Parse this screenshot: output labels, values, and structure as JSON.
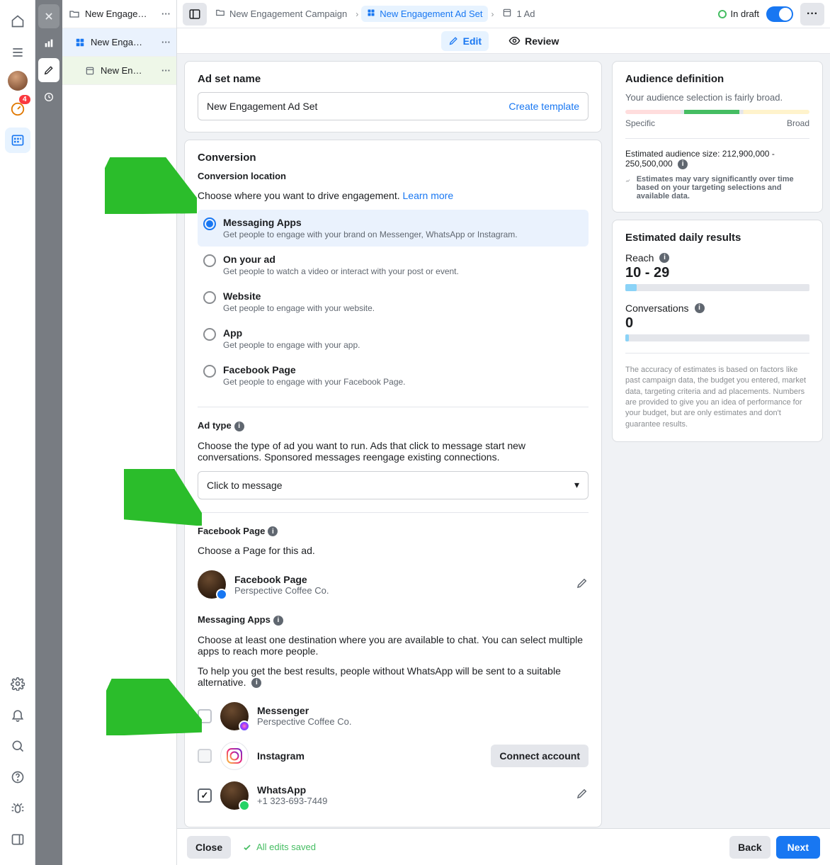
{
  "leftbar": {
    "badge": "4"
  },
  "tree": {
    "l1": "New Engage…",
    "l2": "New Enga…",
    "l3": "New En…"
  },
  "crumbs": {
    "campaign": "New Engagement Campaign",
    "adset": "New Engagement Ad Set",
    "ad": "1 Ad"
  },
  "status": "In draft",
  "tabs": {
    "edit": "Edit",
    "review": "Review"
  },
  "adset": {
    "heading": "Ad set name",
    "value": "New Engagement Ad Set",
    "template_link": "Create template"
  },
  "conversion": {
    "heading": "Conversion",
    "sub": "Conversion location",
    "help": "Choose where you want to drive engagement. ",
    "learn": "Learn more",
    "options": [
      {
        "t": "Messaging Apps",
        "d": "Get people to engage with your brand on Messenger, WhatsApp or Instagram."
      },
      {
        "t": "On your ad",
        "d": "Get people to watch a video or interact with your post or event."
      },
      {
        "t": "Website",
        "d": "Get people to engage with your website."
      },
      {
        "t": "App",
        "d": "Get people to engage with your app."
      },
      {
        "t": "Facebook Page",
        "d": "Get people to engage with your Facebook Page."
      }
    ]
  },
  "adtype": {
    "heading": "Ad type",
    "help": "Choose the type of ad you want to run. Ads that click to message start new conversations. Sponsored messages reengage existing connections.",
    "value": "Click to message"
  },
  "fbpage": {
    "heading": "Facebook Page",
    "help": "Choose a Page for this ad.",
    "title": "Facebook Page",
    "sub": "Perspective Coffee Co."
  },
  "msgapps": {
    "heading": "Messaging Apps",
    "help1": "Choose at least one destination where you are available to chat. You can select multiple apps to reach more people.",
    "help2": "To help you get the best results, people without WhatsApp will be sent to a suitable alternative. ",
    "messenger": {
      "t": "Messenger",
      "d": "Perspective Coffee Co."
    },
    "instagram": {
      "t": "Instagram",
      "btn": "Connect account"
    },
    "whatsapp": {
      "t": "WhatsApp",
      "d": "+1 323-693-7449"
    }
  },
  "audience": {
    "heading": "Audience definition",
    "sub": "Your audience selection is fairly broad.",
    "specific": "Specific",
    "broad": "Broad",
    "size_label": "Estimated audience size: ",
    "size_val": "212,900,000 - 250,500,000",
    "note": "Estimates may vary significantly over time based on your targeting selections and available data."
  },
  "daily": {
    "heading": "Estimated daily results",
    "reach_label": "Reach",
    "reach_val": "10 - 29",
    "conv_label": "Conversations",
    "conv_val": "0",
    "disclaimer": "The accuracy of estimates is based on factors like past campaign data, the budget you entered, market data, targeting criteria and ad placements. Numbers are provided to give you an idea of performance for your budget, but are only estimates and don't guarantee results."
  },
  "footer": {
    "close": "Close",
    "saved": "All edits saved",
    "back": "Back",
    "next": "Next"
  }
}
